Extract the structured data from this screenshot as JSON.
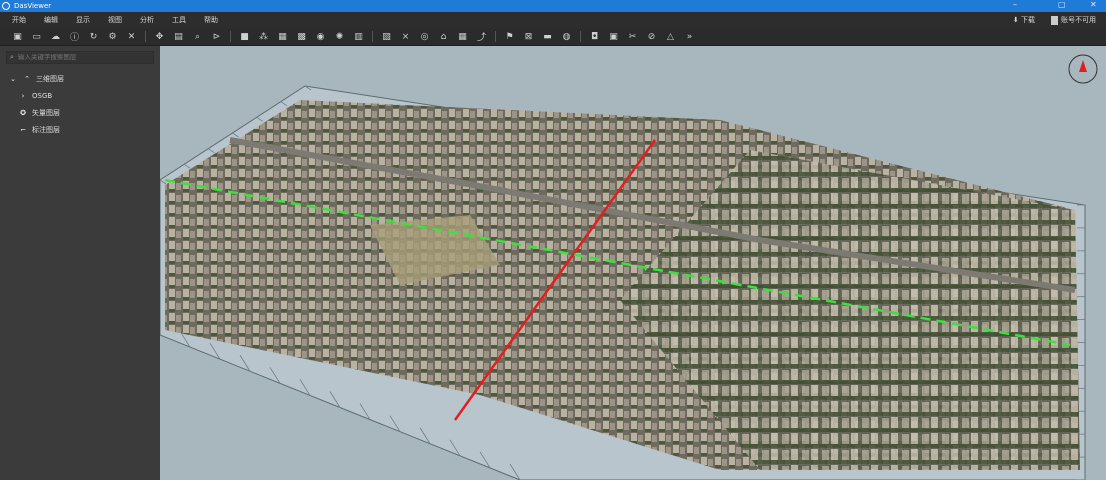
{
  "window": {
    "title": "DasViewer",
    "controls": [
      "–",
      "▢",
      "✕"
    ]
  },
  "menu": [
    "开始",
    "编辑",
    "显示",
    "视图",
    "分析",
    "工具",
    "帮助"
  ],
  "menu_right": {
    "download": "下载",
    "account": "账号不可用"
  },
  "toolbar_groups": [
    [
      "new-file",
      "open-folder",
      "cloud-upload",
      "info",
      "refresh",
      "settings",
      "close"
    ],
    [
      "move",
      "export",
      "search",
      "measure"
    ],
    [
      "layer",
      "nodes",
      "model",
      "grid",
      "globe",
      "sun",
      "texture"
    ],
    [
      "clip",
      "flatten",
      "rotate",
      "terrain",
      "tile",
      "edit"
    ],
    [
      "flag",
      "cross",
      "rect",
      "location"
    ],
    [
      "record",
      "snapshot",
      "scissors",
      "link",
      "triangle",
      "more"
    ]
  ],
  "toolbar_glyphs": [
    "▣",
    "▭",
    "☁",
    "ⓘ",
    "↻",
    "⚙",
    "✕",
    "✥",
    "▤",
    "⌕",
    "⊳",
    "■",
    "⁂",
    "▦",
    "▩",
    "◉",
    "✺",
    "▥",
    "▧",
    "⨯",
    "◎",
    "⌂",
    "▦",
    "⤴",
    "⚑",
    "⊠",
    "▬",
    "◍",
    "◘",
    "▣",
    "✂",
    "⊘",
    "△",
    "»"
  ],
  "sidebar": {
    "search_placeholder": "输入关键字搜索图层",
    "tree": [
      {
        "label": "三维图层",
        "icon": "layers-icon",
        "glyph": "⌃",
        "expander": "⌄"
      },
      {
        "label": "OSGB",
        "icon": "chevron-right-icon",
        "glyph": "›"
      },
      {
        "label": "矢量图层",
        "icon": "vector-icon",
        "glyph": "✪"
      },
      {
        "label": "标注图层",
        "icon": "annotation-icon",
        "glyph": "⌐"
      }
    ]
  },
  "colors": {
    "titlebar": "#1f7ad8",
    "viewport": "#a8b6be",
    "measure_line": "#e02020",
    "profile_line": "#3ee03e"
  }
}
